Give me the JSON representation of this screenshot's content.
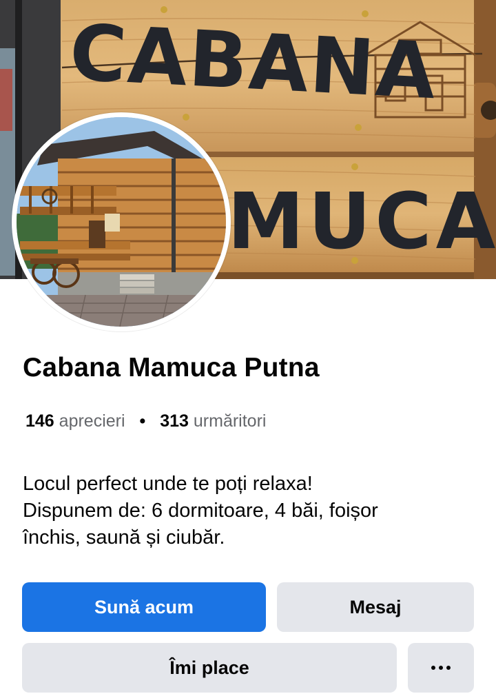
{
  "profile": {
    "name": "Cabana Mamuca Putna",
    "likes_count": "146",
    "likes_label": "aprecieri",
    "separator": "•",
    "followers_count": "313",
    "followers_label": "urmăritori",
    "bio_lines": [
      "Locul perfect unde te poți relaxa!",
      "Dispunem de: 6 dormitoare, 4 băi, foișor",
      "închis, saună și ciubăr."
    ]
  },
  "cover": {
    "sign_line1": "CABANA",
    "sign_line2": "MUCA"
  },
  "actions": {
    "call_label": "Sună acum",
    "message_label": "Mesaj",
    "like_label": "Îmi place",
    "more_icon": "more-dots-icon"
  },
  "colors": {
    "primary": "#1b74e4",
    "secondary_button": "#e4e6eb",
    "muted_text": "#65676b"
  }
}
